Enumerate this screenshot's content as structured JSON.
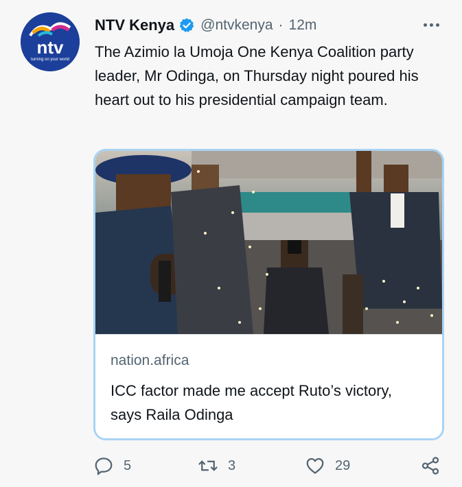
{
  "tweet": {
    "author_name": "NTV Kenya",
    "handle": "@ntvkenya",
    "separator": "·",
    "time": "12m",
    "text": "The Azimio la Umoja One Kenya Coalition party leader, Mr Odinga, on Thursday night poured his heart out to his presidential campaign team.",
    "verified": true,
    "avatar_logo_text": "ntv",
    "avatar_tagline": "turning on your world",
    "avatar_color": "#1b3f9a"
  },
  "card": {
    "domain": "nation.africa",
    "headline": "ICC factor made me accept Ruto’s victory, says Raila Odinga",
    "border_color": "#a8d3f4"
  },
  "actions": {
    "reply_count": "5",
    "retweet_count": "3",
    "like_count": "29"
  },
  "icons": [
    "more-icon",
    "verified-badge-icon",
    "reply-icon",
    "retweet-icon",
    "like-icon",
    "share-icon"
  ],
  "colors": {
    "text": "#0f1419",
    "secondary": "#536471",
    "verified": "#1d9bf0"
  }
}
